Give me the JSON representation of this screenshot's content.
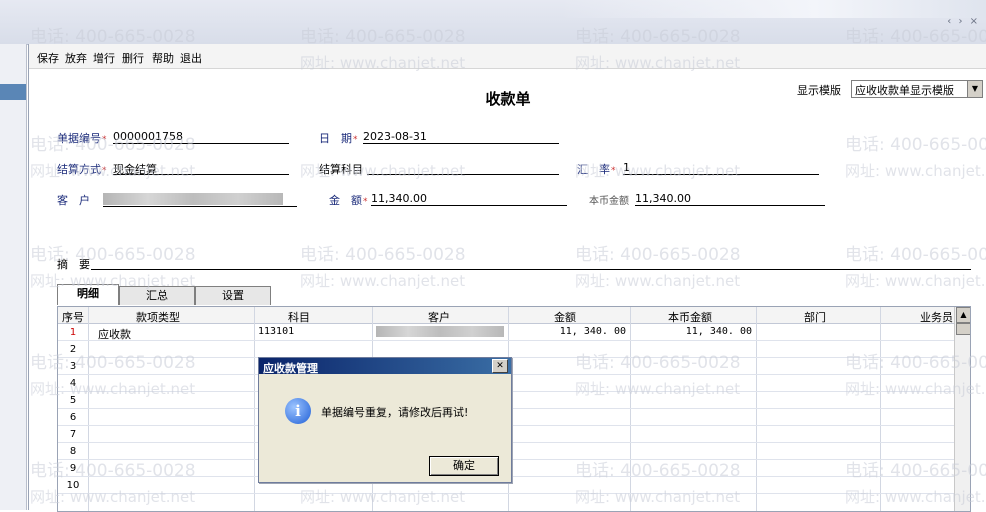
{
  "menu": [
    "保存",
    "放弃",
    "增行",
    "删行",
    "帮助",
    "退出"
  ],
  "title": "收款单",
  "template": {
    "label": "显示模版",
    "value": "应收收款单显示模版"
  },
  "fields": {
    "doc_no": {
      "label": "单据编号",
      "value": "0000001758"
    },
    "date": {
      "label": "日　期",
      "value": "2023-08-31"
    },
    "settle_method": {
      "label": "结算方式",
      "value": "现金结算"
    },
    "settle_account": {
      "label": "结算科目",
      "value": ""
    },
    "rate": {
      "label": "汇　率",
      "value": "1"
    },
    "customer": {
      "label": "客　户"
    },
    "amount": {
      "label": "金　额",
      "value": "11,340.00"
    },
    "local_amount": {
      "label": "本币金额",
      "value": "11,340.00"
    },
    "summary": {
      "label": "摘　要",
      "value": ""
    }
  },
  "tabs": [
    "明细",
    "汇总",
    "设置"
  ],
  "grid": {
    "headers": [
      "序号",
      "款项类型",
      "科目",
      "客户",
      "金额",
      "本币金额",
      "部门",
      "业务员"
    ],
    "rows": [
      {
        "no": "1",
        "type": "应收款",
        "account": "113101",
        "amount": "11, 340. 00",
        "local": "11, 340. 00"
      },
      {
        "no": "2"
      },
      {
        "no": "3"
      },
      {
        "no": "4"
      },
      {
        "no": "5"
      },
      {
        "no": "6"
      },
      {
        "no": "7"
      },
      {
        "no": "8"
      },
      {
        "no": "9"
      },
      {
        "no": "10"
      }
    ]
  },
  "dialog": {
    "title": "应收款管理",
    "message": "单据编号重复，请修改后再试!",
    "ok": "确定"
  },
  "watermark": {
    "phone": "电话: 400-665-0028",
    "site": "网址: www.chanjet.net"
  },
  "colors": {
    "dialog_title": "#0a246a",
    "required_star": "#cc3333"
  }
}
